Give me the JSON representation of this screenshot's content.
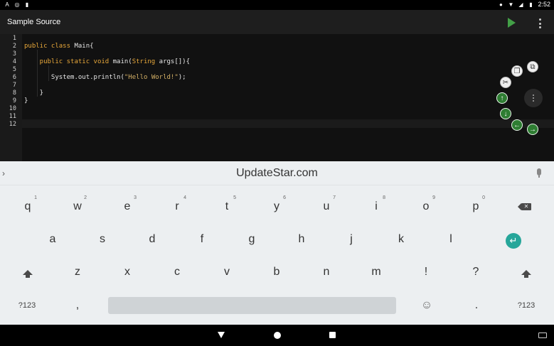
{
  "status_bar": {
    "time": "2:52"
  },
  "app": {
    "title": "Sample Source"
  },
  "editor": {
    "line_numbers": [
      "1",
      "2",
      "3",
      "4",
      "5",
      "6",
      "7",
      "8",
      "9",
      "10",
      "11",
      "12"
    ],
    "lines": [
      {
        "n": 2,
        "parts": [
          {
            "t": "public class ",
            "k": "kw"
          },
          {
            "t": "Main{",
            "k": ""
          }
        ]
      },
      {
        "n": 4,
        "parts": [
          {
            "t": "    public static void ",
            "k": "kw"
          },
          {
            "t": "main(",
            "k": ""
          },
          {
            "t": "String",
            "k": "kw"
          },
          {
            "t": " args[]){",
            "k": ""
          }
        ]
      },
      {
        "n": 6,
        "parts": [
          {
            "t": "       System.out.println(",
            "k": ""
          },
          {
            "t": "\"Hello World!\"",
            "k": "str"
          },
          {
            "t": ");",
            "k": ""
          }
        ]
      },
      {
        "n": 8,
        "parts": [
          {
            "t": "    }",
            "k": ""
          }
        ]
      },
      {
        "n": 9,
        "parts": [
          {
            "t": "}",
            "k": ""
          }
        ]
      }
    ]
  },
  "keyboard": {
    "suggestion": "UpdateStar.com",
    "row1": [
      {
        "k": "q",
        "h": "1"
      },
      {
        "k": "w",
        "h": "2"
      },
      {
        "k": "e",
        "h": "3"
      },
      {
        "k": "r",
        "h": "4"
      },
      {
        "k": "t",
        "h": "5"
      },
      {
        "k": "y",
        "h": "6"
      },
      {
        "k": "u",
        "h": "7"
      },
      {
        "k": "i",
        "h": "8"
      },
      {
        "k": "o",
        "h": "9"
      },
      {
        "k": "p",
        "h": "0"
      }
    ],
    "row2": [
      "a",
      "s",
      "d",
      "f",
      "g",
      "h",
      "j",
      "k",
      "l"
    ],
    "row3": [
      "z",
      "x",
      "c",
      "v",
      "b",
      "n",
      "m",
      "!",
      "?"
    ],
    "row4": {
      "sym_left": "?123",
      "comma": ",",
      "emoji": "☺",
      "period": ".",
      "sym_right": "?123"
    }
  },
  "icons": {
    "run": "play-icon",
    "overflow": "more-vert-icon",
    "tools": [
      "copy-icon",
      "paste-icon",
      "cut-icon",
      "arrow-up-icon",
      "arrow-down-icon",
      "arrow-left-icon",
      "arrow-right-icon"
    ]
  },
  "colors": {
    "accent": "#26a69a",
    "run": "#43a047",
    "keyword": "#e8a83a"
  }
}
